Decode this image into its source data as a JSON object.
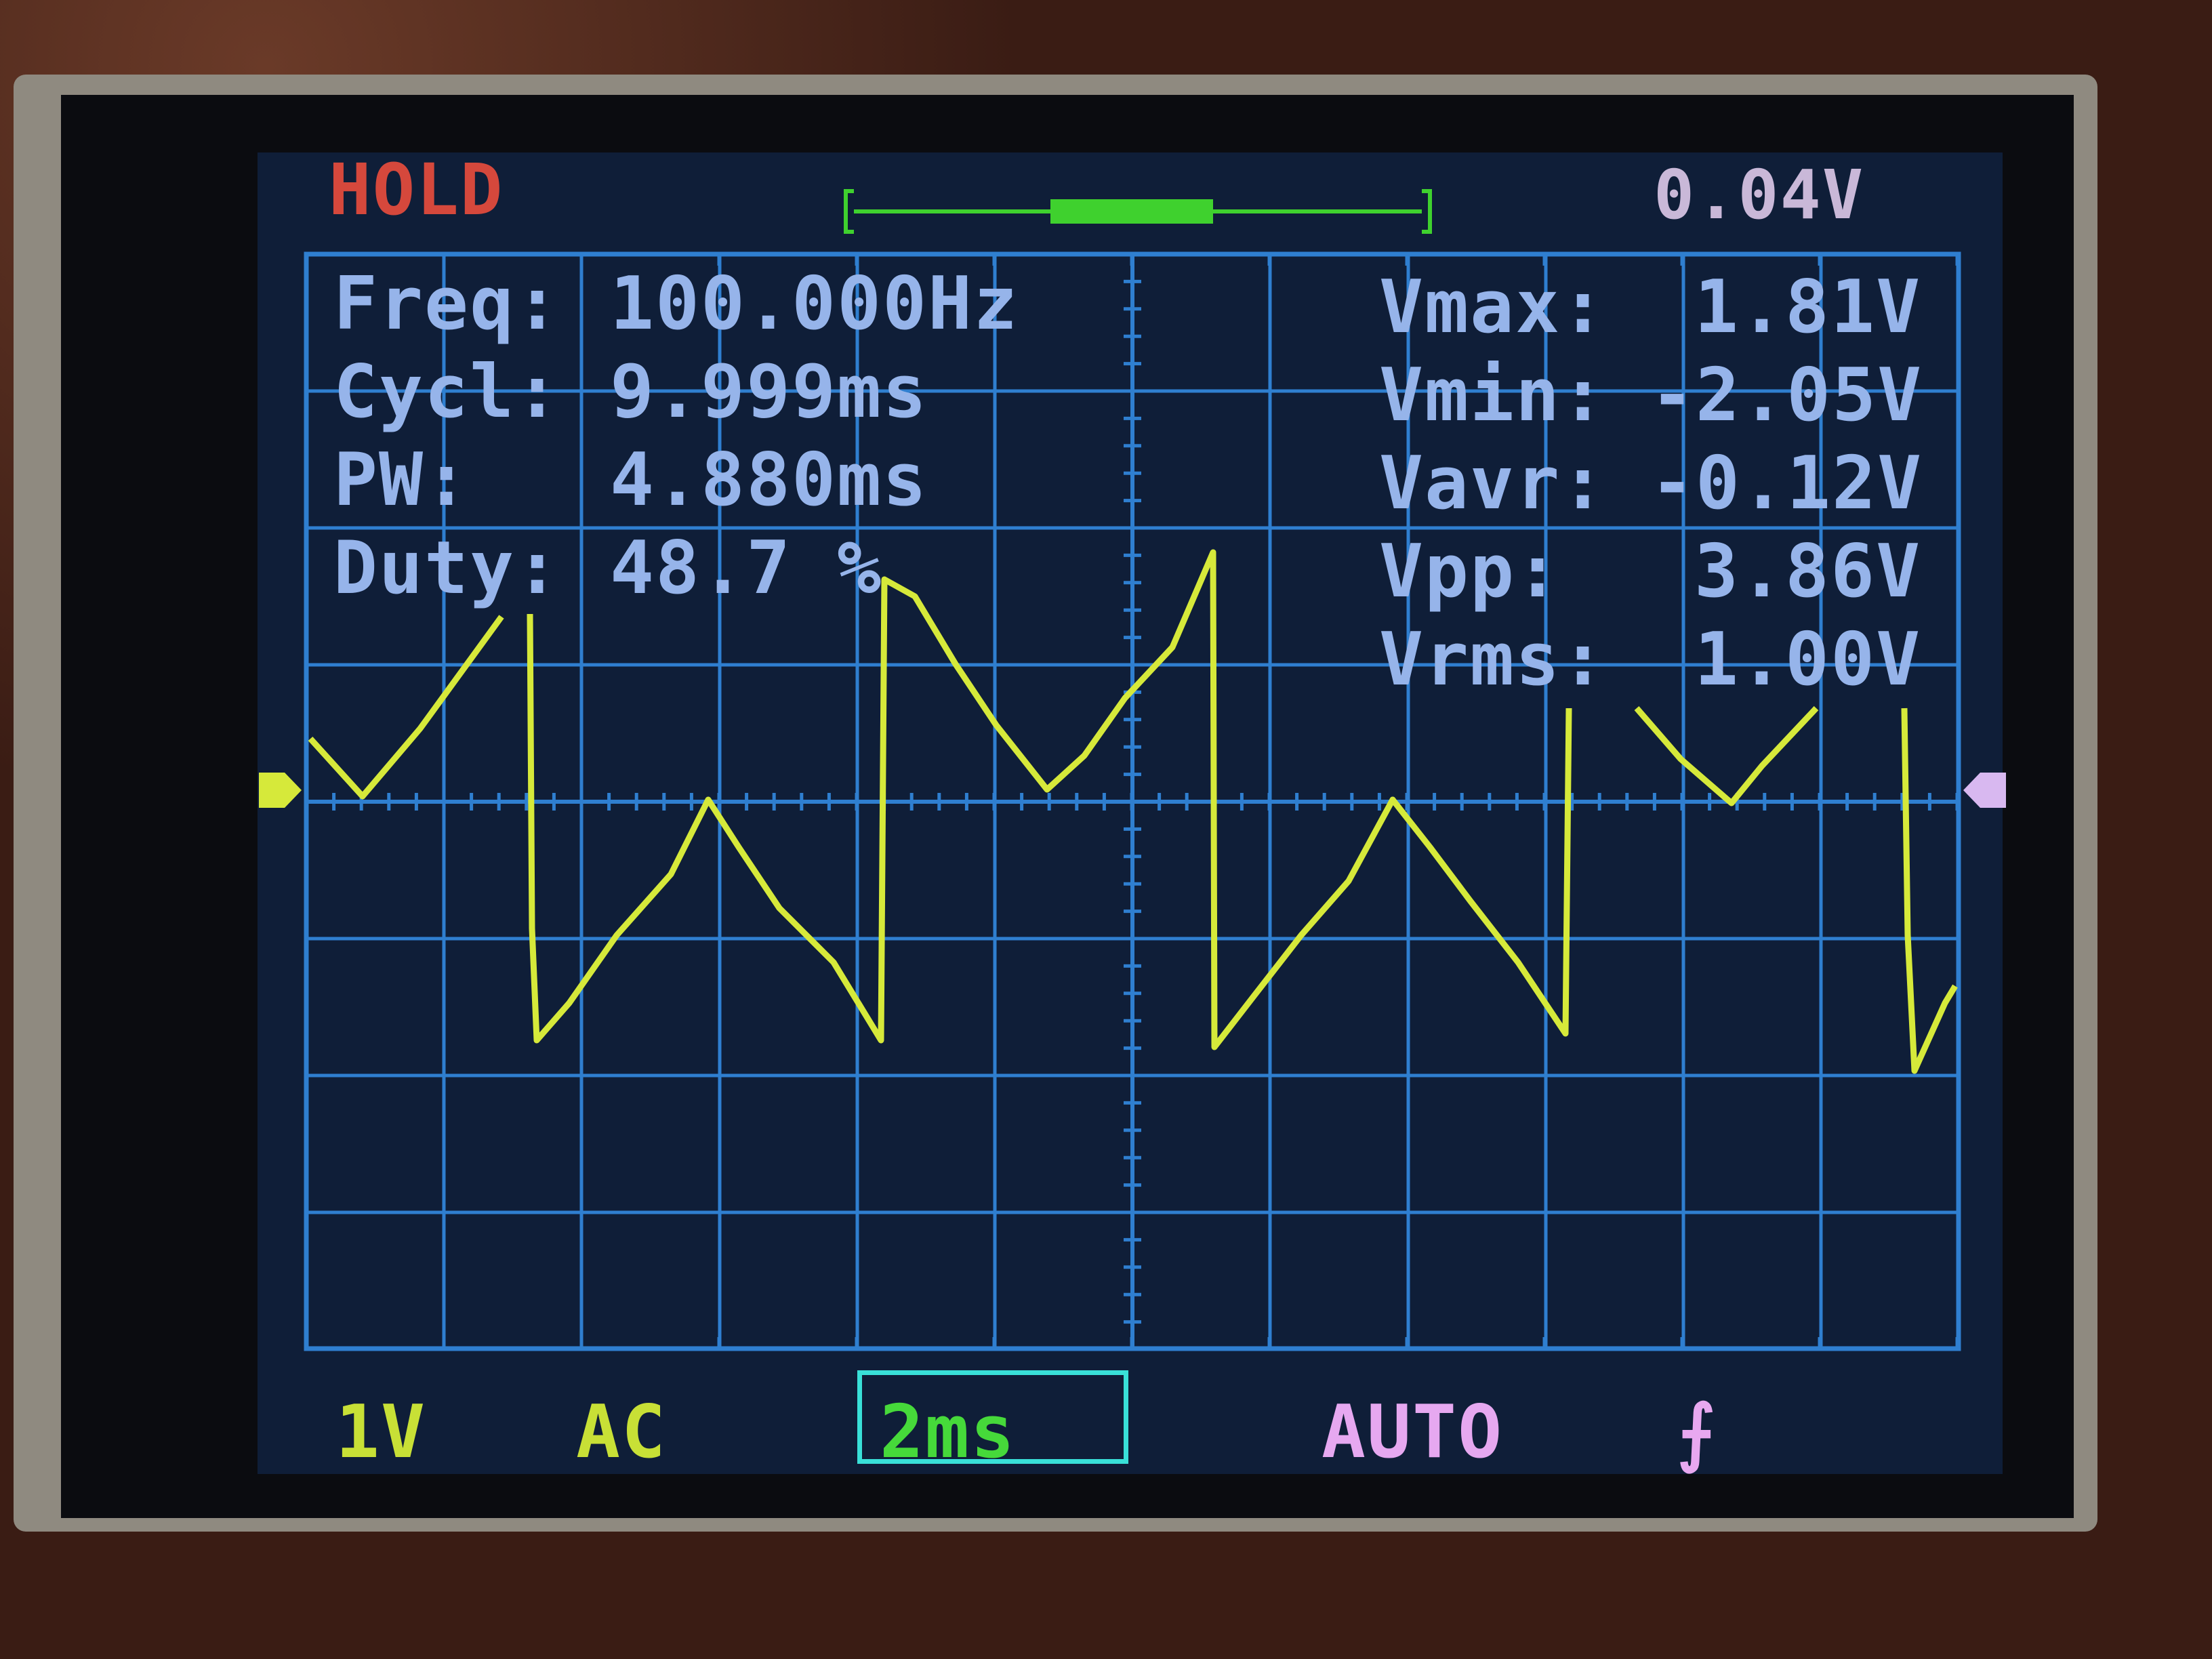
{
  "status": {
    "hold": "HOLD",
    "trigger_level": "0.04V"
  },
  "measurements": {
    "left": [
      {
        "label": "Freq:",
        "value": "100.000Hz"
      },
      {
        "label": "Cycl:",
        "value": "9.999ms"
      },
      {
        "label": "PW:",
        "value": "4.880ms"
      },
      {
        "label": "Duty:",
        "value": "48.7 %"
      }
    ],
    "right": [
      {
        "label": "Vmax:",
        "value": "1.81V"
      },
      {
        "label": "Vmin:",
        "value": "-2.05V"
      },
      {
        "label": "Vavr:",
        "value": "-0.12V"
      },
      {
        "label": "Vpp:",
        "value": "3.86V"
      },
      {
        "label": "Vrms:",
        "value": "1.00V"
      }
    ]
  },
  "bottom_bar": {
    "volts_per_div": "1V",
    "coupling": "AC",
    "timebase": "2ms",
    "trigger_mode": "AUTO",
    "trigger_edge_icon": "falling-edge-icon"
  },
  "colors": {
    "screen_bg": "#0f1e38",
    "grid": "#2f7fd0",
    "trace": "#d6e93a",
    "hold": "#d5483c",
    "measurement_text": "#96b4ea",
    "timebase_box": "#39e0d8",
    "trigger_marker": "#d8b8f0"
  }
}
